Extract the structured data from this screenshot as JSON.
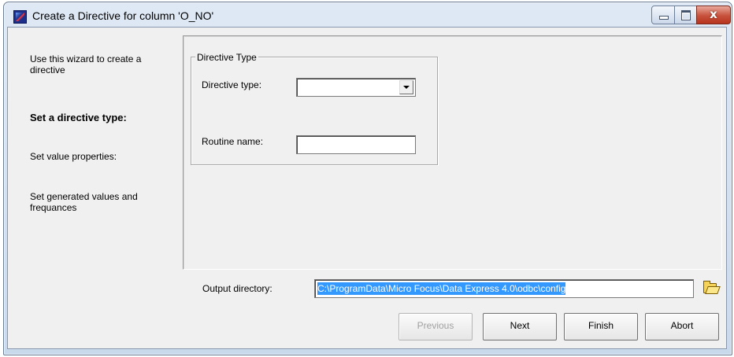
{
  "window": {
    "title": "Create a Directive for column 'O_NO'",
    "controls": {
      "minimize_icon": "minimize-icon",
      "maximize_icon": "maximize-icon",
      "close_glyph": "x"
    }
  },
  "steps": [
    {
      "label": "Use this wizard to create a directive",
      "active": false
    },
    {
      "label": "Set a directive type:",
      "active": true
    },
    {
      "label": "Set value properties:",
      "active": false
    },
    {
      "label": "Set generated values and frequances",
      "active": false
    }
  ],
  "directive_group": {
    "legend": "Directive Type",
    "directive_type_label": "Directive type:",
    "directive_type_value": "",
    "routine_name_label": "Routine name:",
    "routine_name_value": ""
  },
  "output": {
    "label": "Output directory:",
    "value": "C:\\ProgramData\\Micro Focus\\Data Express 4.0\\odbc\\config",
    "browse_icon": "folder-icon"
  },
  "buttons": {
    "previous": "Previous",
    "next": "Next",
    "finish": "Finish",
    "abort": "Abort"
  }
}
